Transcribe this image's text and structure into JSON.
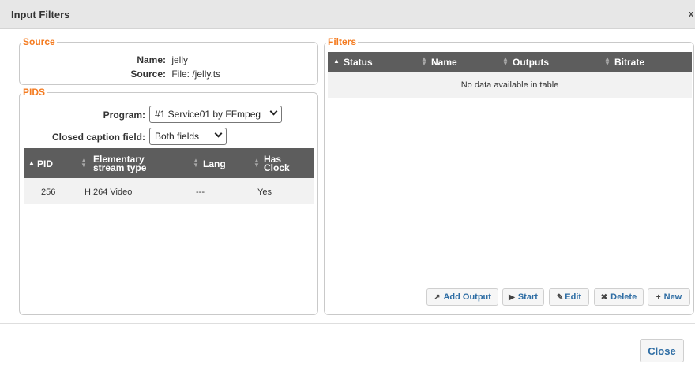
{
  "dialog": {
    "title": "Input Filters",
    "close_glyph": "x",
    "close_button": "Close"
  },
  "source": {
    "legend": "Source",
    "name_label": "Name:",
    "name_value": "jelly",
    "source_label": "Source:",
    "source_value": "File: /jelly.ts"
  },
  "pids": {
    "legend": "PIDS",
    "program_label": "Program:",
    "program_value": "#1 Service01 by FFmpeg",
    "caption_label": "Closed caption field:",
    "caption_value": "Both fields",
    "columns": [
      "PID",
      "Elementary stream type",
      "Lang",
      "Has Clock"
    ],
    "column_lines": [
      [
        "PID"
      ],
      [
        "Elementary",
        "stream type"
      ],
      [
        "Lang"
      ],
      [
        "Has",
        "Clock"
      ]
    ],
    "rows": [
      [
        "256",
        "H.264 Video",
        "---",
        "Yes"
      ]
    ]
  },
  "filters": {
    "legend": "Filters",
    "columns": [
      "Status",
      "Name",
      "Outputs",
      "Bitrate"
    ],
    "empty_message": "No data available in table",
    "buttons": {
      "add_output": "Add Output",
      "start": "Start",
      "edit": "Edit",
      "delete": "Delete",
      "new": "New"
    }
  },
  "icons": {
    "add_output": "arrow-up-right-icon",
    "start": "play-icon",
    "edit": "pencil-icon",
    "delete": "x-icon",
    "new": "plus-icon"
  },
  "colors": {
    "legend": "#f47b20",
    "table_header": "#5d5d5d",
    "button_text": "#2e6da4"
  }
}
